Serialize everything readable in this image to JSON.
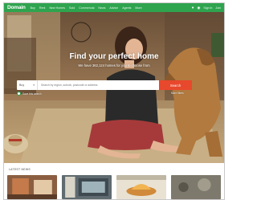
{
  "nav": {
    "logo": "Domain",
    "links": [
      "Buy",
      "Rent",
      "New Homes",
      "Sold",
      "Commercial",
      "News",
      "Advice",
      "Agents",
      "More"
    ],
    "promo": "Find out what your home could be worth",
    "right": [
      "Sign in",
      "Join"
    ]
  },
  "hero": {
    "title": "Find your perfect home",
    "subtitle": "We have 362,124 homes for you to choose from"
  },
  "search": {
    "mode": "Buy",
    "placeholder": "Search by region, suburb, postcode or address",
    "button": "Search",
    "save_label": "Save this search",
    "more_filters": "More filters"
  },
  "news": {
    "heading": "LATEST NEWS"
  },
  "colors": {
    "brand_green": "#2fa44f",
    "search_button": "#e8482c"
  }
}
